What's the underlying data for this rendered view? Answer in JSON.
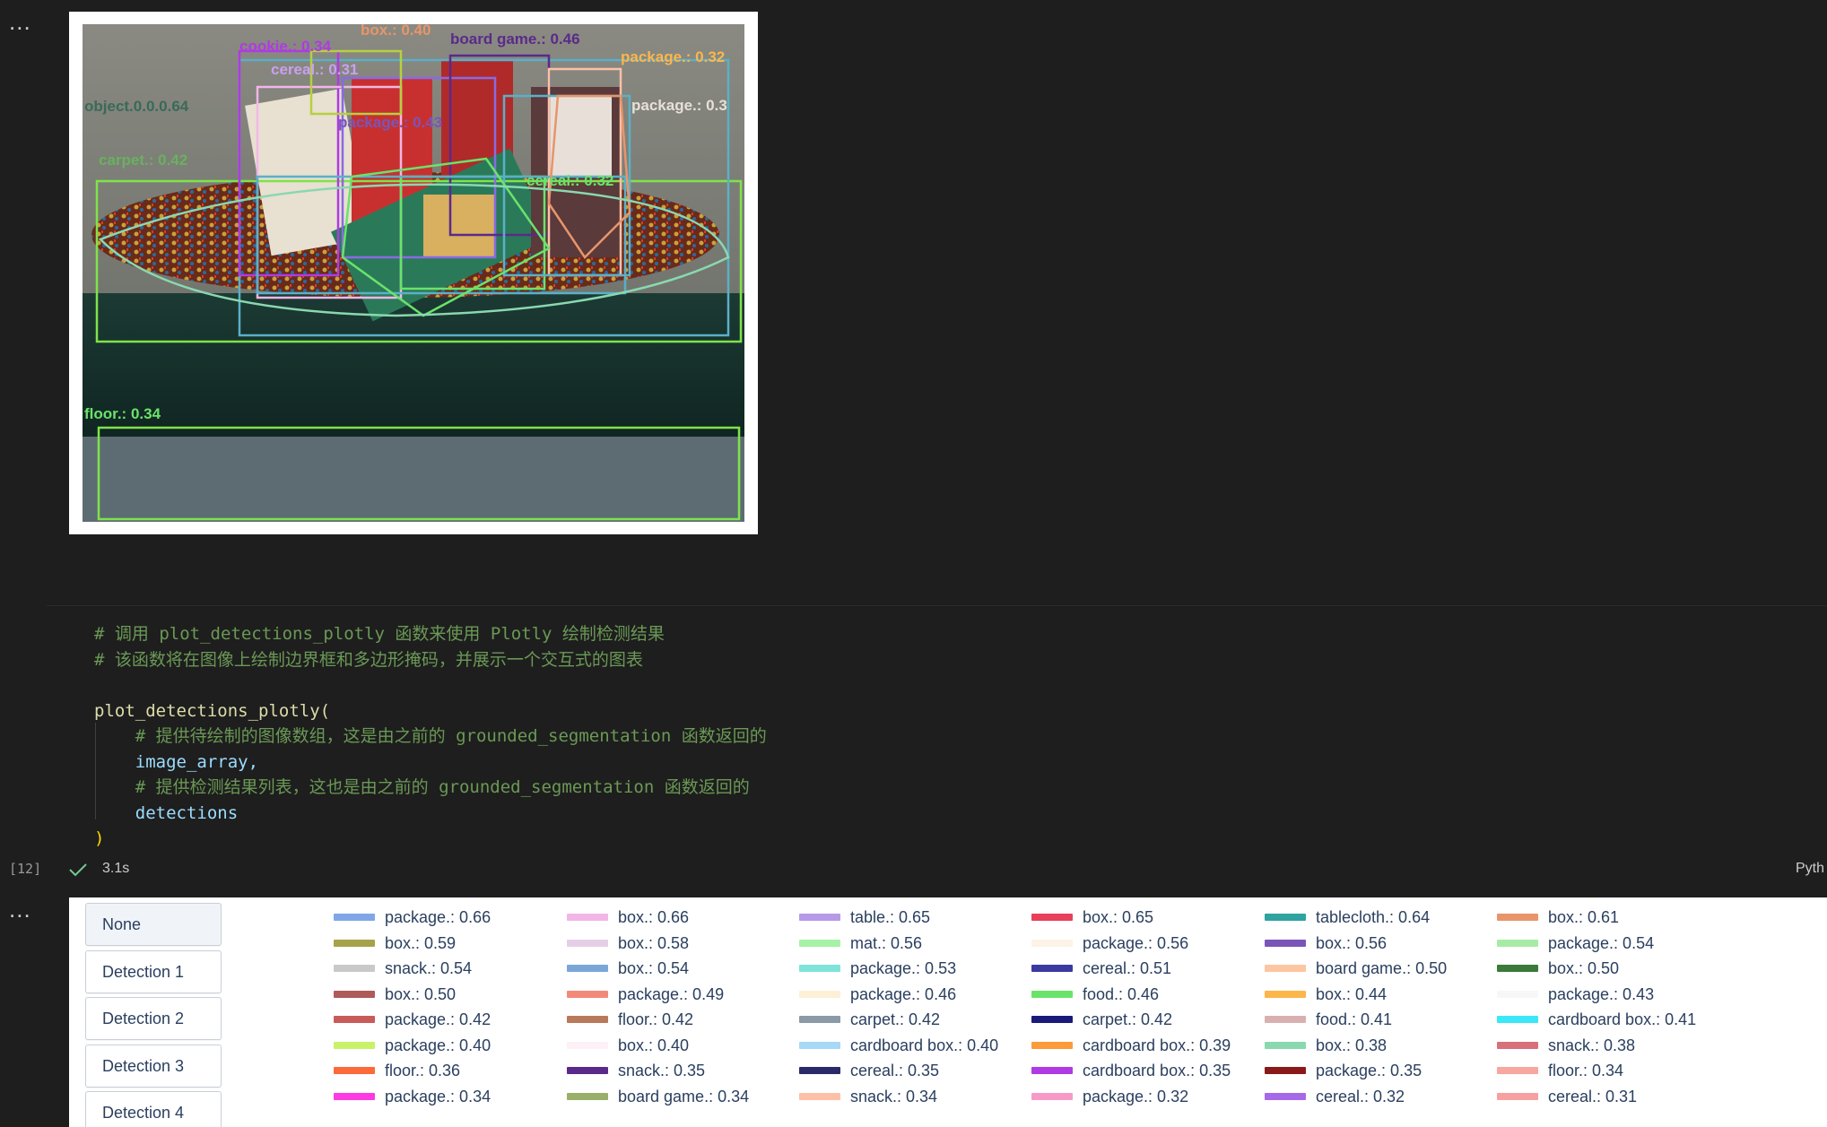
{
  "notebook": {
    "output_menu_glyph": "...",
    "cell": {
      "execution_count": "[12]",
      "exec_time": "3.1s",
      "kernel_language": "Pyth",
      "code_lines": [
        "# 调用 plot_detections_plotly 函数来使用 Plotly 绘制检测结果",
        "# 该函数将在图像上绘制边界框和多边形掩码，并展示一个交互式的图表",
        "",
        "plot_detections_plotly(",
        "    # 提供待绘制的图像数组，这是由之前的 grounded_segmentation 函数返回的",
        "    image_array,",
        "    # 提供检测结果列表，这也是由之前的 grounded_segmentation 函数返回的",
        "    detections",
        ")"
      ]
    }
  },
  "image_labels": {
    "floor": "floor.: 0.34",
    "carpet": "carpet.: 0.42",
    "object": "object.0.0.0.64",
    "cereal_top": "cereal.: 0.31",
    "cereal_mid": "cereal.: 0.32",
    "package_right": "package.: 0.32",
    "package_right2": "package.: 0.3",
    "cookie": "cookie.: 0.34",
    "board": "board game.: 0.46",
    "pkg_mid": "package.: 0.43",
    "box_top": "box.: 0.40"
  },
  "plot": {
    "menu_buttons": [
      "None",
      "Detection 1",
      "Detection 2",
      "Detection 3",
      "Detection 4"
    ],
    "legend": [
      {
        "label": "package.: 0.66",
        "color": "#7fa7e8"
      },
      {
        "label": "box.: 0.66",
        "color": "#f2b6e6"
      },
      {
        "label": "table.: 0.65",
        "color": "#b69ae8"
      },
      {
        "label": "box.: 0.65",
        "color": "#e8405a"
      },
      {
        "label": "tablecloth.: 0.64",
        "color": "#2fa3a0"
      },
      {
        "label": "box.: 0.61",
        "color": "#e8956a"
      },
      {
        "label": "box.: 0.59",
        "color": "#a7a24a"
      },
      {
        "label": "box.: 0.58",
        "color": "#e6cfe6"
      },
      {
        "label": "mat.: 0.56",
        "color": "#a6f2a6"
      },
      {
        "label": "package.: 0.56",
        "color": "#fdf3e6"
      },
      {
        "label": "box.: 0.56",
        "color": "#7a55b8"
      },
      {
        "label": "package.: 0.54",
        "color": "#a6eca6"
      },
      {
        "label": "snack.: 0.54",
        "color": "#c9c9c9"
      },
      {
        "label": "box.: 0.54",
        "color": "#7aa7d8"
      },
      {
        "label": "package.: 0.53",
        "color": "#7fe3da"
      },
      {
        "label": "cereal.: 0.51",
        "color": "#3a3aa0"
      },
      {
        "label": "board game.: 0.50",
        "color": "#fdc6a0"
      },
      {
        "label": "box.: 0.50",
        "color": "#3a7a3a"
      },
      {
        "label": "box.: 0.50",
        "color": "#b05a5a"
      },
      {
        "label": "package.: 0.49",
        "color": "#f28a7a"
      },
      {
        "label": "package.: 0.46",
        "color": "#fdf0d6"
      },
      {
        "label": "food.: 0.46",
        "color": "#6ae36a"
      },
      {
        "label": "box.: 0.44",
        "color": "#fdb64a"
      },
      {
        "label": "package.: 0.43",
        "color": "#f7f7f7"
      },
      {
        "label": "package.: 0.42",
        "color": "#c95a5a"
      },
      {
        "label": "floor.: 0.42",
        "color": "#b87a5a"
      },
      {
        "label": "carpet.: 0.42",
        "color": "#8a9aa6"
      },
      {
        "label": "carpet.: 0.42",
        "color": "#1a1a7a"
      },
      {
        "label": "food.: 0.41",
        "color": "#d8b0b0"
      },
      {
        "label": "cardboard box.: 0.41",
        "color": "#3ae8f7"
      },
      {
        "label": "package.: 0.40",
        "color": "#c9f26a"
      },
      {
        "label": "box.: 0.40",
        "color": "#fdf0f6"
      },
      {
        "label": "cardboard box.: 0.40",
        "color": "#a6d8f7"
      },
      {
        "label": "cardboard box.: 0.39",
        "color": "#fd9a3a"
      },
      {
        "label": "box.: 0.38",
        "color": "#8ad8b0"
      },
      {
        "label": "snack.: 0.38",
        "color": "#d8707a"
      },
      {
        "label": "floor.: 0.36",
        "color": "#fd6a3a"
      },
      {
        "label": "snack.: 0.35",
        "color": "#5a2a8a"
      },
      {
        "label": "cereal.: 0.35",
        "color": "#2a2a6a"
      },
      {
        "label": "cardboard box.: 0.35",
        "color": "#b03ae3"
      },
      {
        "label": "package.: 0.35",
        "color": "#8a1a1a"
      },
      {
        "label": "floor.: 0.34",
        "color": "#f7a6a0"
      },
      {
        "label": "package.: 0.34",
        "color": "#fd3ae3"
      },
      {
        "label": "board game.: 0.34",
        "color": "#9ab06a"
      },
      {
        "label": "snack.: 0.34",
        "color": "#fdc0a6"
      },
      {
        "label": "package.: 0.32",
        "color": "#f79ac8"
      },
      {
        "label": "cereal.: 0.32",
        "color": "#a66ae8"
      },
      {
        "label": "cereal.: 0.31",
        "color": "#f7a0a0"
      }
    ]
  }
}
